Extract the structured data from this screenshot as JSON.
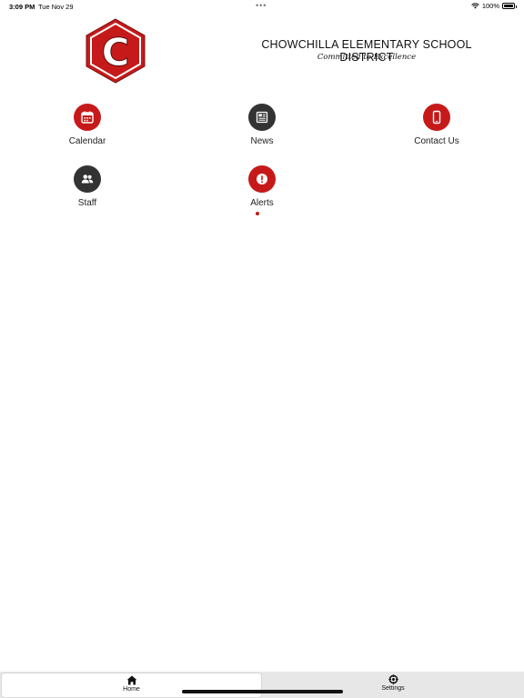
{
  "status_bar": {
    "time": "3:09 PM",
    "date": "Tue Nov 29",
    "dots": "•••",
    "battery_text": "100%",
    "icons": [
      "wifi-icon",
      "battery-icon"
    ]
  },
  "header": {
    "logo_letter": "C",
    "district_name": "CHOWCHILLA ELEMENTARY SCHOOL DISTRICT",
    "tagline": "Committed to Excellence",
    "colors": {
      "brand_red": "#c61a1a",
      "dark": "#333333"
    }
  },
  "tiles": [
    {
      "label": "Calendar",
      "icon": "calendar-icon",
      "color": "red"
    },
    {
      "label": "News",
      "icon": "newspaper-icon",
      "color": "dark"
    },
    {
      "label": "Contact Us",
      "icon": "phone-icon",
      "color": "red"
    },
    {
      "label": "Staff",
      "icon": "people-icon",
      "color": "dark"
    },
    {
      "label": "Alerts",
      "icon": "alert-icon",
      "color": "red",
      "has_badge": true
    }
  ],
  "tab_bar": {
    "tabs": [
      {
        "label": "Home",
        "icon": "home-icon",
        "active": true
      },
      {
        "label": "Settings",
        "icon": "settings-icon",
        "active": false
      }
    ]
  }
}
